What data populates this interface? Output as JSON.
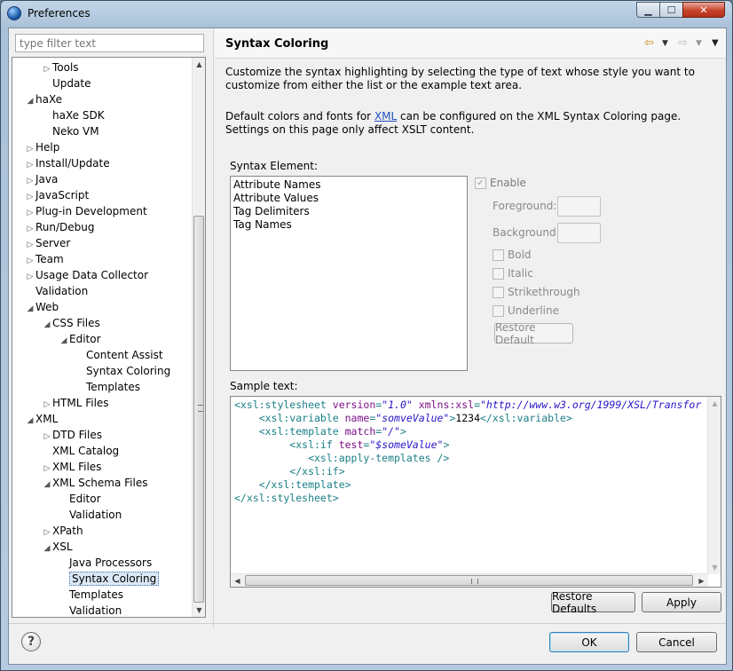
{
  "window": {
    "title": "Preferences"
  },
  "filter": {
    "placeholder": "type filter text"
  },
  "tree": [
    {
      "label": "Tools",
      "level": 2,
      "arrow": "▷"
    },
    {
      "label": "Update",
      "level": 2,
      "arrow": ""
    },
    {
      "label": "haXe",
      "level": 1,
      "arrow": "◢"
    },
    {
      "label": "haXe SDK",
      "level": 2,
      "arrow": ""
    },
    {
      "label": "Neko VM",
      "level": 2,
      "arrow": ""
    },
    {
      "label": "Help",
      "level": 1,
      "arrow": "▷"
    },
    {
      "label": "Install/Update",
      "level": 1,
      "arrow": "▷"
    },
    {
      "label": "Java",
      "level": 1,
      "arrow": "▷"
    },
    {
      "label": "JavaScript",
      "level": 1,
      "arrow": "▷"
    },
    {
      "label": "Plug-in Development",
      "level": 1,
      "arrow": "▷"
    },
    {
      "label": "Run/Debug",
      "level": 1,
      "arrow": "▷"
    },
    {
      "label": "Server",
      "level": 1,
      "arrow": "▷"
    },
    {
      "label": "Team",
      "level": 1,
      "arrow": "▷"
    },
    {
      "label": "Usage Data Collector",
      "level": 1,
      "arrow": "▷"
    },
    {
      "label": "Validation",
      "level": 1,
      "arrow": ""
    },
    {
      "label": "Web",
      "level": 1,
      "arrow": "◢"
    },
    {
      "label": "CSS Files",
      "level": 2,
      "arrow": "◢"
    },
    {
      "label": "Editor",
      "level": 3,
      "arrow": "◢"
    },
    {
      "label": "Content Assist",
      "level": 4,
      "arrow": ""
    },
    {
      "label": "Syntax Coloring",
      "level": 4,
      "arrow": ""
    },
    {
      "label": "Templates",
      "level": 4,
      "arrow": ""
    },
    {
      "label": "HTML Files",
      "level": 2,
      "arrow": "▷"
    },
    {
      "label": "XML",
      "level": 1,
      "arrow": "◢"
    },
    {
      "label": "DTD Files",
      "level": 2,
      "arrow": "▷"
    },
    {
      "label": "XML Catalog",
      "level": 2,
      "arrow": ""
    },
    {
      "label": "XML Files",
      "level": 2,
      "arrow": "▷"
    },
    {
      "label": "XML Schema Files",
      "level": 2,
      "arrow": "◢"
    },
    {
      "label": "Editor",
      "level": 3,
      "arrow": ""
    },
    {
      "label": "Validation",
      "level": 3,
      "arrow": ""
    },
    {
      "label": "XPath",
      "level": 2,
      "arrow": "▷"
    },
    {
      "label": "XSL",
      "level": 2,
      "arrow": "◢"
    },
    {
      "label": "Java Processors",
      "level": 3,
      "arrow": ""
    },
    {
      "label": "Syntax Coloring",
      "level": 3,
      "arrow": "",
      "selected": true
    },
    {
      "label": "Templates",
      "level": 3,
      "arrow": ""
    },
    {
      "label": "Validation",
      "level": 3,
      "arrow": ""
    }
  ],
  "page": {
    "title": "Syntax Coloring",
    "desc1": "Customize the syntax highlighting by selecting the type of text whose style you want to customize from either the list or the example text area.",
    "desc2_pre": "Default colors and fonts for ",
    "desc2_link": "XML",
    "desc2_post": " can be configured on the XML Syntax Coloring page.  Settings on this page only affect XSLT content.",
    "syntax_element_label": "Syntax Element:",
    "syntax_elements": [
      "Attribute Names",
      "Attribute Values",
      "Tag Delimiters",
      "Tag Names"
    ],
    "enable": "Enable",
    "foreground": "Foreground:",
    "background": "Background:",
    "bold": "Bold",
    "italic": "Italic",
    "strikethrough": "Strikethrough",
    "underline": "Underline",
    "restore_default": "Restore Default",
    "sample_label": "Sample text:",
    "restore_defaults": "Restore Defaults",
    "apply": "Apply"
  },
  "sample_code": [
    [
      [
        "t",
        "<xsl:stylesheet "
      ],
      [
        "a",
        "version"
      ],
      [
        "t",
        "="
      ],
      [
        "v",
        "\"1.0\""
      ],
      [
        "t",
        " "
      ],
      [
        "a",
        "xmlns:xsl"
      ],
      [
        "t",
        "="
      ],
      [
        "v",
        "\"http://www.w3.org/1999/XSL/Transfor"
      ]
    ],
    [
      [
        "t",
        "    <xsl:variable "
      ],
      [
        "a",
        "name"
      ],
      [
        "t",
        "="
      ],
      [
        "v",
        "\"somveValue\""
      ],
      [
        "t",
        ">"
      ],
      [
        "txt",
        "1234"
      ],
      [
        "t",
        "</xsl:variable>"
      ]
    ],
    [
      [
        "t",
        "    <xsl:template "
      ],
      [
        "a",
        "match"
      ],
      [
        "t",
        "="
      ],
      [
        "v",
        "\"/\""
      ],
      [
        "t",
        ">"
      ]
    ],
    [
      [
        "t",
        "         <xsl:if "
      ],
      [
        "a",
        "test"
      ],
      [
        "t",
        "="
      ],
      [
        "v",
        "\"$someValue\""
      ],
      [
        "t",
        ">"
      ]
    ],
    [
      [
        "t",
        "            <xsl:apply-templates />"
      ]
    ],
    [
      [
        "t",
        "         </xsl:if>"
      ]
    ],
    [
      [
        "t",
        "    </xsl:template>"
      ]
    ],
    [
      [
        "t",
        "</xsl:stylesheet>"
      ]
    ]
  ],
  "footer": {
    "ok": "OK",
    "cancel": "Cancel"
  },
  "colors": {
    "tag": "#1a7f86",
    "attr": "#7d0f8a",
    "value": "#2a16c8",
    "link": "#1e4fc1"
  }
}
